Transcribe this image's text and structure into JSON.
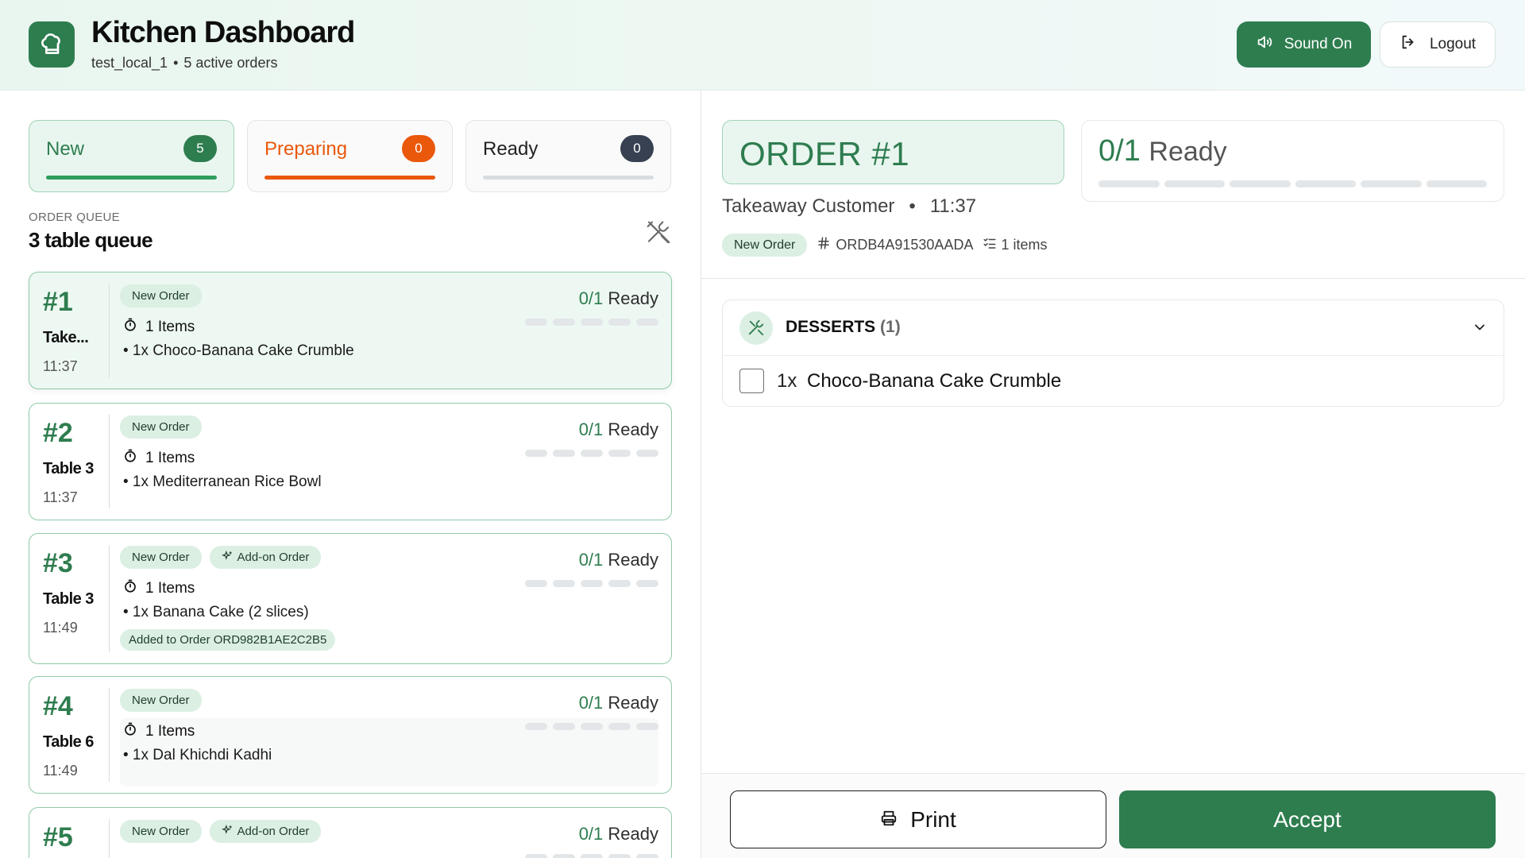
{
  "header": {
    "title": "Kitchen Dashboard",
    "account": "test_local_1",
    "separator": "•",
    "active_orders": "5 active orders",
    "sound_label": "Sound On",
    "logout_label": "Logout"
  },
  "tabs": [
    {
      "label": "New",
      "count": "5",
      "color": "#2e7d4f",
      "bar_color": "#2e9e5e"
    },
    {
      "label": "Preparing",
      "count": "0",
      "color": "#ea580c",
      "bar_color": "#ea580c"
    },
    {
      "label": "Ready",
      "count": "0",
      "color": "#374151",
      "bar_color": "#d9dcdf"
    }
  ],
  "queue": {
    "kicker": "ORDER QUEUE",
    "title": "3 table queue"
  },
  "orders": [
    {
      "num": "#1",
      "table": "Take...",
      "time": "11:37",
      "tags": [
        "New Order"
      ],
      "ready": "0/1",
      "ready_word": "Ready",
      "items": "1 Items",
      "line": "• 1x Choco-Banana Cake Crumble"
    },
    {
      "num": "#2",
      "table": "Table 3",
      "time": "11:37",
      "tags": [
        "New Order"
      ],
      "ready": "0/1",
      "ready_word": "Ready",
      "items": "1 Items",
      "line": "• 1x Mediterranean Rice Bowl"
    },
    {
      "num": "#3",
      "table": "Table 3",
      "time": "11:49",
      "tags": [
        "New Order",
        "Add-on Order"
      ],
      "ready": "0/1",
      "ready_word": "Ready",
      "items": "1 Items",
      "line": "• 1x Banana Cake (2 slices)",
      "added": "Added to Order ORD982B1AE2C2B5"
    },
    {
      "num": "#4",
      "table": "Table 6",
      "time": "11:49",
      "tags": [
        "New Order"
      ],
      "ready": "0/1",
      "ready_word": "Ready",
      "items": "1 Items",
      "line": "• 1x Dal Khichdi Kadhi"
    },
    {
      "num": "#5",
      "tags": [
        "New Order",
        "Add-on Order"
      ],
      "ready": "0/1",
      "ready_word": "Ready"
    }
  ],
  "detail": {
    "order_title": "ORDER #1",
    "ready_frac": "0/1",
    "ready_word": "Ready",
    "customer": "Takeaway Customer",
    "bullet": "•",
    "time": "11:37",
    "status_tag": "New Order",
    "order_id": "ORDB4A91530AADA",
    "items_count": "1 items",
    "category": "DESSERTS",
    "category_count": "(1)",
    "item_qty": "1x",
    "item_name": "Choco-Banana Cake Crumble"
  },
  "footer": {
    "print_label": "Print",
    "accept_label": "Accept"
  },
  "colors": {
    "brand": "#2e7d4f",
    "preparing": "#ea580c"
  },
  "icons": {
    "logo": "chef-hat-icon",
    "sound": "speaker-icon",
    "logout": "logout-icon",
    "queue": "utensils-crossed-icon",
    "items": "timer-icon",
    "addon": "sparkles-icon",
    "order_id": "hash-icon",
    "items_count": "list-checks-icon",
    "category": "utensils-crossed-icon",
    "chevron": "chevron-down-icon",
    "print": "printer-icon"
  }
}
